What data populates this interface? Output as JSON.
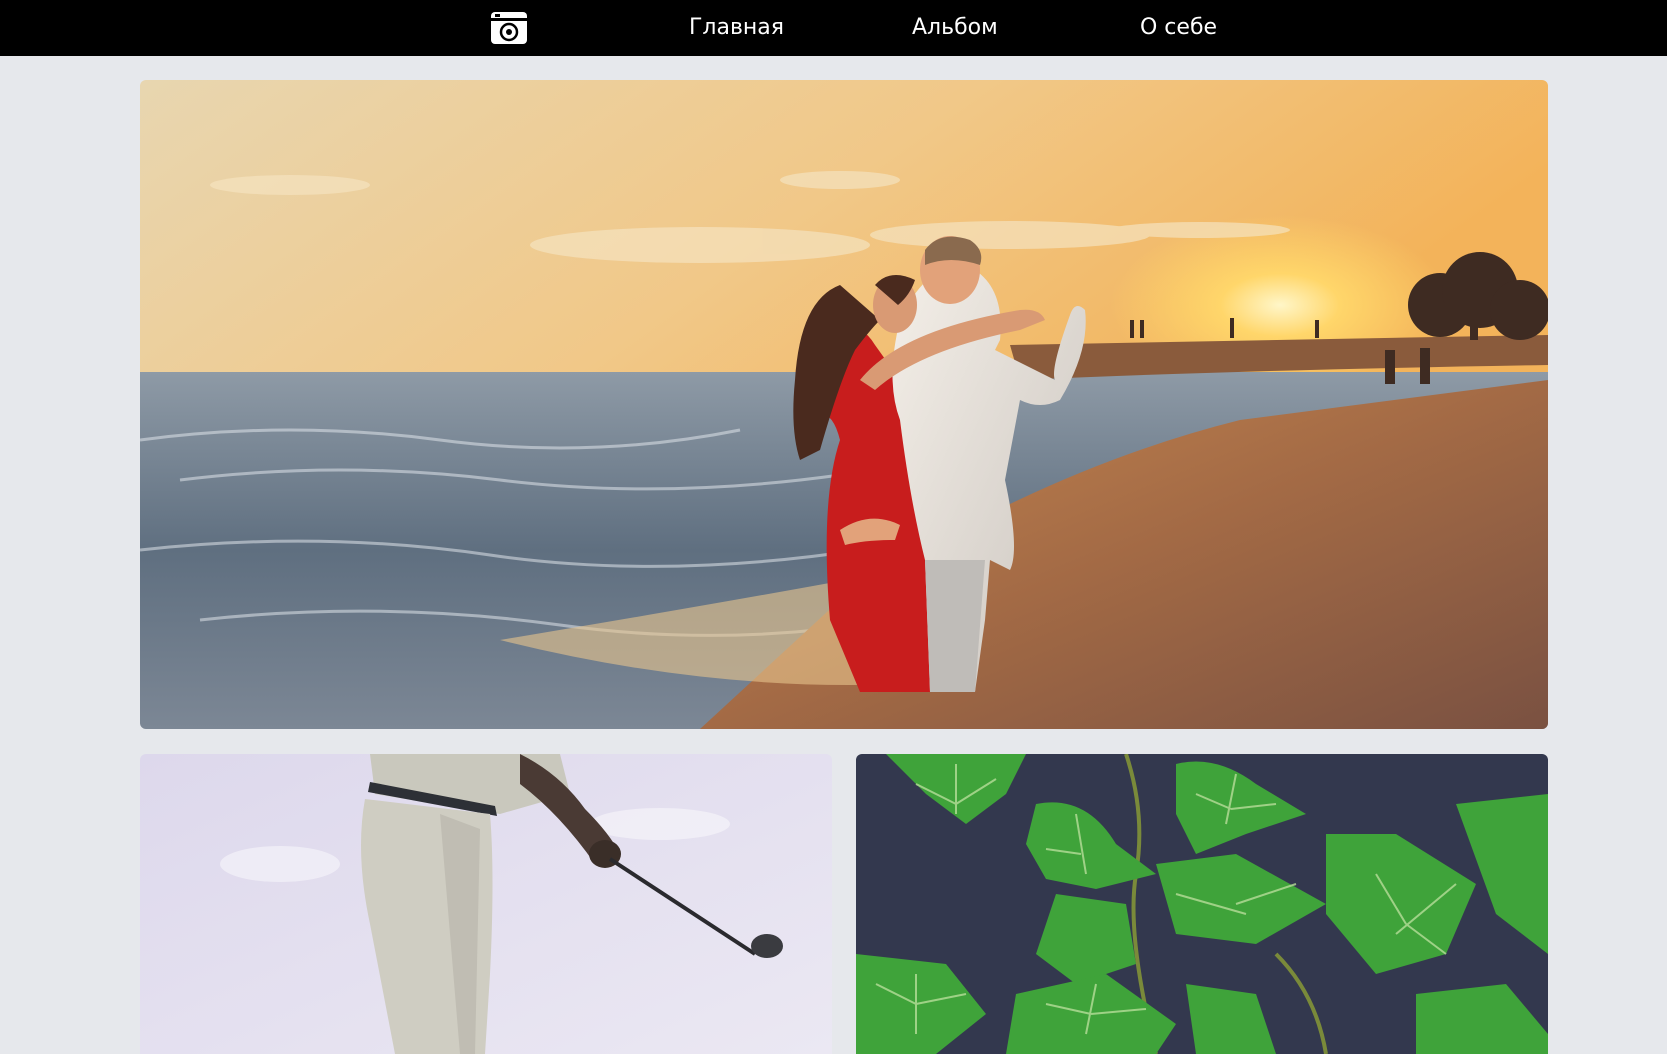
{
  "nav": {
    "logo_icon": "camera-icon",
    "items": [
      {
        "label": "Главная"
      },
      {
        "label": "Альбом"
      },
      {
        "label": "О себе"
      }
    ]
  },
  "gallery": {
    "photos": [
      {
        "subject": "couple-kissing-on-beach-at-sunset"
      },
      {
        "subject": "golfer-swinging-club"
      },
      {
        "subject": "green-ivy-leaves"
      }
    ]
  },
  "colors": {
    "topbar": "#000000",
    "page_background": "#e6e8ec",
    "nav_text": "#ffffff"
  }
}
